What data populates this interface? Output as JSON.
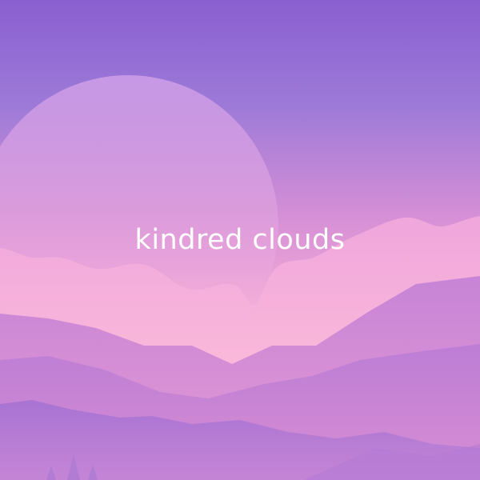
{
  "title": "kindred clouds",
  "colors": {
    "sky_top": "#8a5fd0",
    "sky_mid": "#d58fd6",
    "sky_horizon": "#ffc7d2",
    "moon": "#d4a3e6",
    "clouds": "#f2b6df",
    "mountain_back": "#c882d2",
    "mountain_mid": "#b877d6",
    "mountain_front": "#a56fd0",
    "title_text": "#ffffff"
  },
  "icons": [
    "moon-shape",
    "cloud-band",
    "mountain-range",
    "pine-trees"
  ]
}
